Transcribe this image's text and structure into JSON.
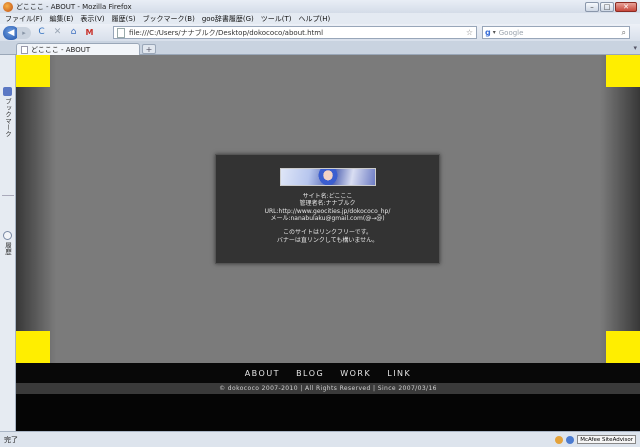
{
  "window": {
    "title": "どこここ - ABOUT - Mozilla Firefox",
    "min": "–",
    "max": "□",
    "close": "✕"
  },
  "menu": [
    "ファイル(F)",
    "編集(E)",
    "表示(V)",
    "履歴(S)",
    "ブックマーク(B)",
    "goo辞書履歴(G)",
    "ツール(T)",
    "ヘルプ(H)"
  ],
  "nav": {
    "url": "file:///C:/Users/ナナブルク/Desktop/dokococo/about.html",
    "search_placeholder": "Google",
    "back_icon": "◀",
    "forward_icon": "▸",
    "reload_icon": "C",
    "stop_icon": "✕",
    "home_icon": "⌂",
    "gmail_icon": "M",
    "star_icon": "☆",
    "search_engine": "g",
    "search_icon": "⌕"
  },
  "tab": {
    "label": "どこここ - ABOUT",
    "new_tab": "+",
    "list": "▾"
  },
  "sidebar": {
    "bookmarks": "ブックマーク",
    "history": "履歴"
  },
  "page": {
    "card_lines": [
      "サイト名:どこここ",
      "管理者名:ナナブルク",
      "URL:http://www.geocities.jp/dokococo_hp/",
      "メール:nanabulaku@gmail.com(@→@)",
      "",
      "このサイトはリンクフリーです。",
      "バナーは直リンクしても構いません。"
    ],
    "footer_nav": [
      "ABOUT",
      "BLOG",
      "WORK",
      "LINK"
    ],
    "copyright": "© dokococo 2007-2010  |  All Rights Reserved  |  Since 2007/03/16",
    "accent_color": "#ffee00"
  },
  "status": {
    "text": "完了",
    "mcafee": "McAfee SiteAdvisor"
  }
}
